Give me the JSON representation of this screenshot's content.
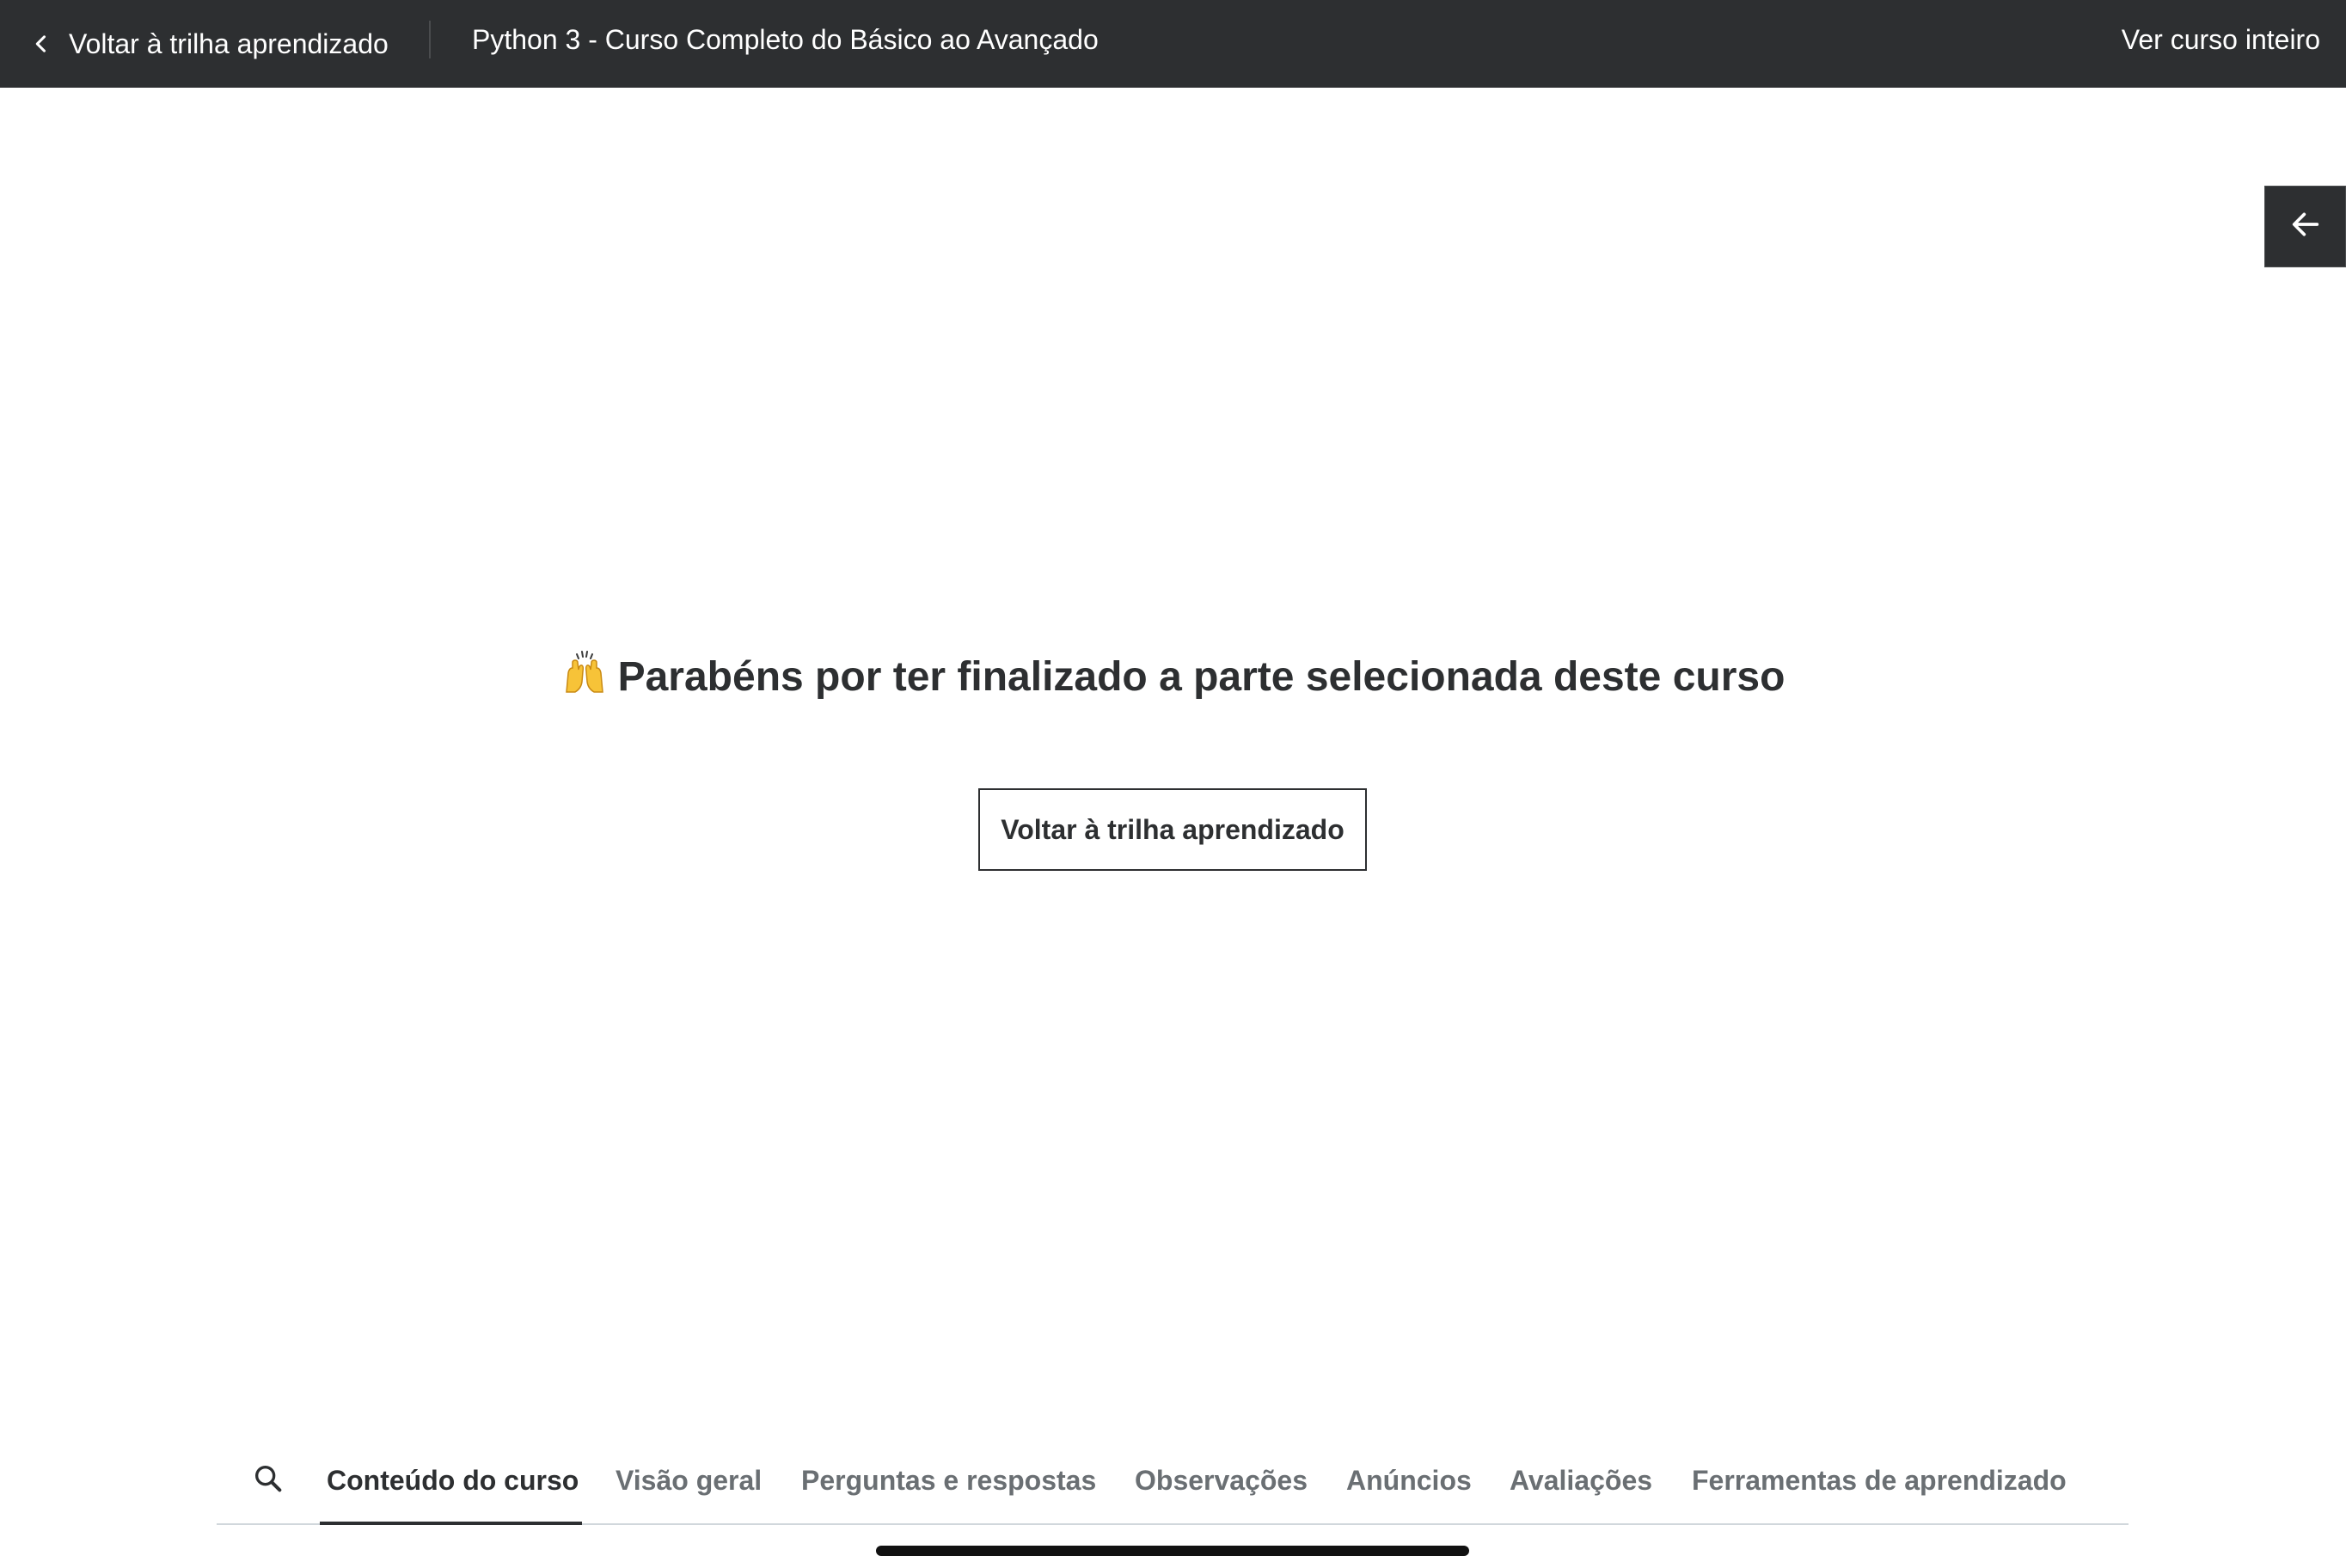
{
  "header": {
    "back_label": "Voltar à trilha aprendizado",
    "course_title": "Python 3 - Curso Completo do Básico ao Avançado",
    "view_full_course": "Ver curso inteiro"
  },
  "main": {
    "congrats_emoji": "🙌",
    "congrats_text": "Parabéns por ter finalizado a parte selecionada deste curso",
    "return_button": "Voltar à trilha aprendizado"
  },
  "tabs": {
    "active": "Conteúdo do curso",
    "items": [
      {
        "label": "Conteúdo do curso"
      },
      {
        "label": "Visão geral"
      },
      {
        "label": "Perguntas e respostas"
      },
      {
        "label": "Observações"
      },
      {
        "label": "Anúncios"
      },
      {
        "label": "Avaliações"
      },
      {
        "label": "Ferramentas de aprendizado"
      }
    ]
  },
  "icons": {
    "back": "chevron-left-icon",
    "sidebar_toggle": "arrow-left-icon",
    "search": "search-icon",
    "celebrate": "raising-hands-emoji"
  },
  "colors": {
    "topbar_bg": "#2d2f31",
    "text_primary": "#2d2f31",
    "text_muted": "#6a6f73",
    "border": "#d1d7dc"
  }
}
